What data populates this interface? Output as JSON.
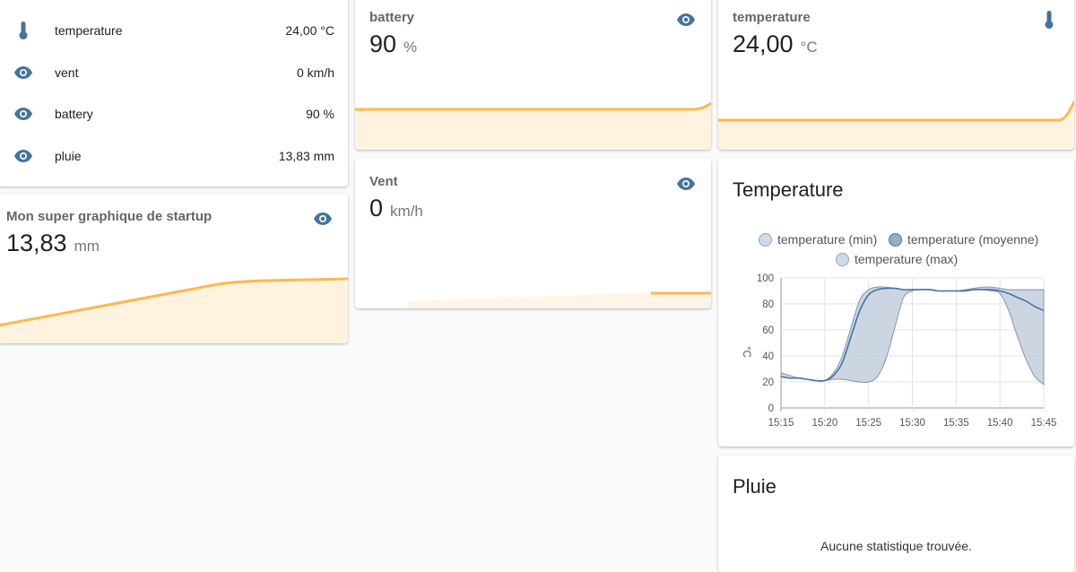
{
  "colors": {
    "accent_icon": "#44739e",
    "spark_line": "#ffb74d",
    "spark_fill": "#fff3e0",
    "chart_line": "#44739e",
    "chart_band": "#c3cfdd"
  },
  "entities": [
    {
      "icon": "thermometer-icon",
      "name": "temperature",
      "value": "24,00 °C"
    },
    {
      "icon": "eye-icon",
      "name": "vent",
      "value": "0 km/h"
    },
    {
      "icon": "eye-icon",
      "name": "battery",
      "value": "90 %"
    },
    {
      "icon": "eye-icon",
      "name": "pluie",
      "value": "13,83 mm"
    }
  ],
  "sensors": {
    "battery": {
      "name": "battery",
      "value": "90",
      "unit": "%",
      "icon": "eye-icon"
    },
    "temperature": {
      "name": "temperature",
      "value": "24,00",
      "unit": "°C",
      "icon": "thermometer-icon"
    },
    "vent": {
      "name": "Vent",
      "value": "0",
      "unit": "km/h",
      "icon": "eye-icon"
    },
    "startup": {
      "name": "Mon super graphique de startup",
      "value": "13,83",
      "unit": "mm",
      "icon": "eye-icon"
    }
  },
  "temp_graph": {
    "title": "Temperature",
    "legend": [
      "temperature (min)",
      "temperature (moyenne)",
      "temperature (max)"
    ]
  },
  "pluie": {
    "title": "Pluie",
    "message": "Aucune statistique trouvée."
  },
  "chart_data": {
    "type": "area",
    "title": "Temperature",
    "xlabel": "",
    "ylabel": "°C",
    "x": [
      "15:15",
      "15:16",
      "15:17",
      "15:18",
      "15:19",
      "15:20",
      "15:21",
      "15:22",
      "15:23",
      "15:24",
      "15:25",
      "15:26",
      "15:27",
      "15:28",
      "15:29",
      "15:30",
      "15:31",
      "15:32",
      "15:33",
      "15:34",
      "15:35",
      "15:36",
      "15:37",
      "15:38",
      "15:39",
      "15:40",
      "15:41",
      "15:42",
      "15:43",
      "15:44",
      "15:45"
    ],
    "x_ticks": [
      "15:15",
      "15:20",
      "15:25",
      "15:30",
      "15:35",
      "15:40",
      "15:45"
    ],
    "ylim": [
      0,
      100
    ],
    "y_ticks": [
      0,
      20,
      40,
      60,
      80,
      100
    ],
    "grid": true,
    "legend_position": "top",
    "series": [
      {
        "name": "temperature (min)",
        "values": [
          27,
          25,
          23,
          22,
          21,
          21,
          22,
          22,
          21,
          20,
          20,
          24,
          38,
          62,
          85,
          90,
          91,
          91,
          90,
          90,
          90,
          90,
          91,
          91,
          90,
          88,
          75,
          55,
          37,
          24,
          18
        ]
      },
      {
        "name": "temperature (moyenne)",
        "values": [
          24,
          23,
          23,
          22,
          21,
          21,
          25,
          35,
          55,
          75,
          87,
          91,
          92,
          92,
          91,
          91,
          91,
          91,
          90,
          90,
          90,
          90,
          91,
          91,
          91,
          90,
          88,
          85,
          82,
          78,
          75
        ]
      },
      {
        "name": "temperature (max)",
        "values": [
          24,
          23,
          23,
          22,
          21,
          21,
          27,
          40,
          62,
          83,
          91,
          93,
          93,
          92,
          91,
          91,
          91,
          91,
          90,
          90,
          90,
          91,
          92,
          93,
          93,
          92,
          91,
          91,
          91,
          91,
          91
        ]
      }
    ]
  }
}
